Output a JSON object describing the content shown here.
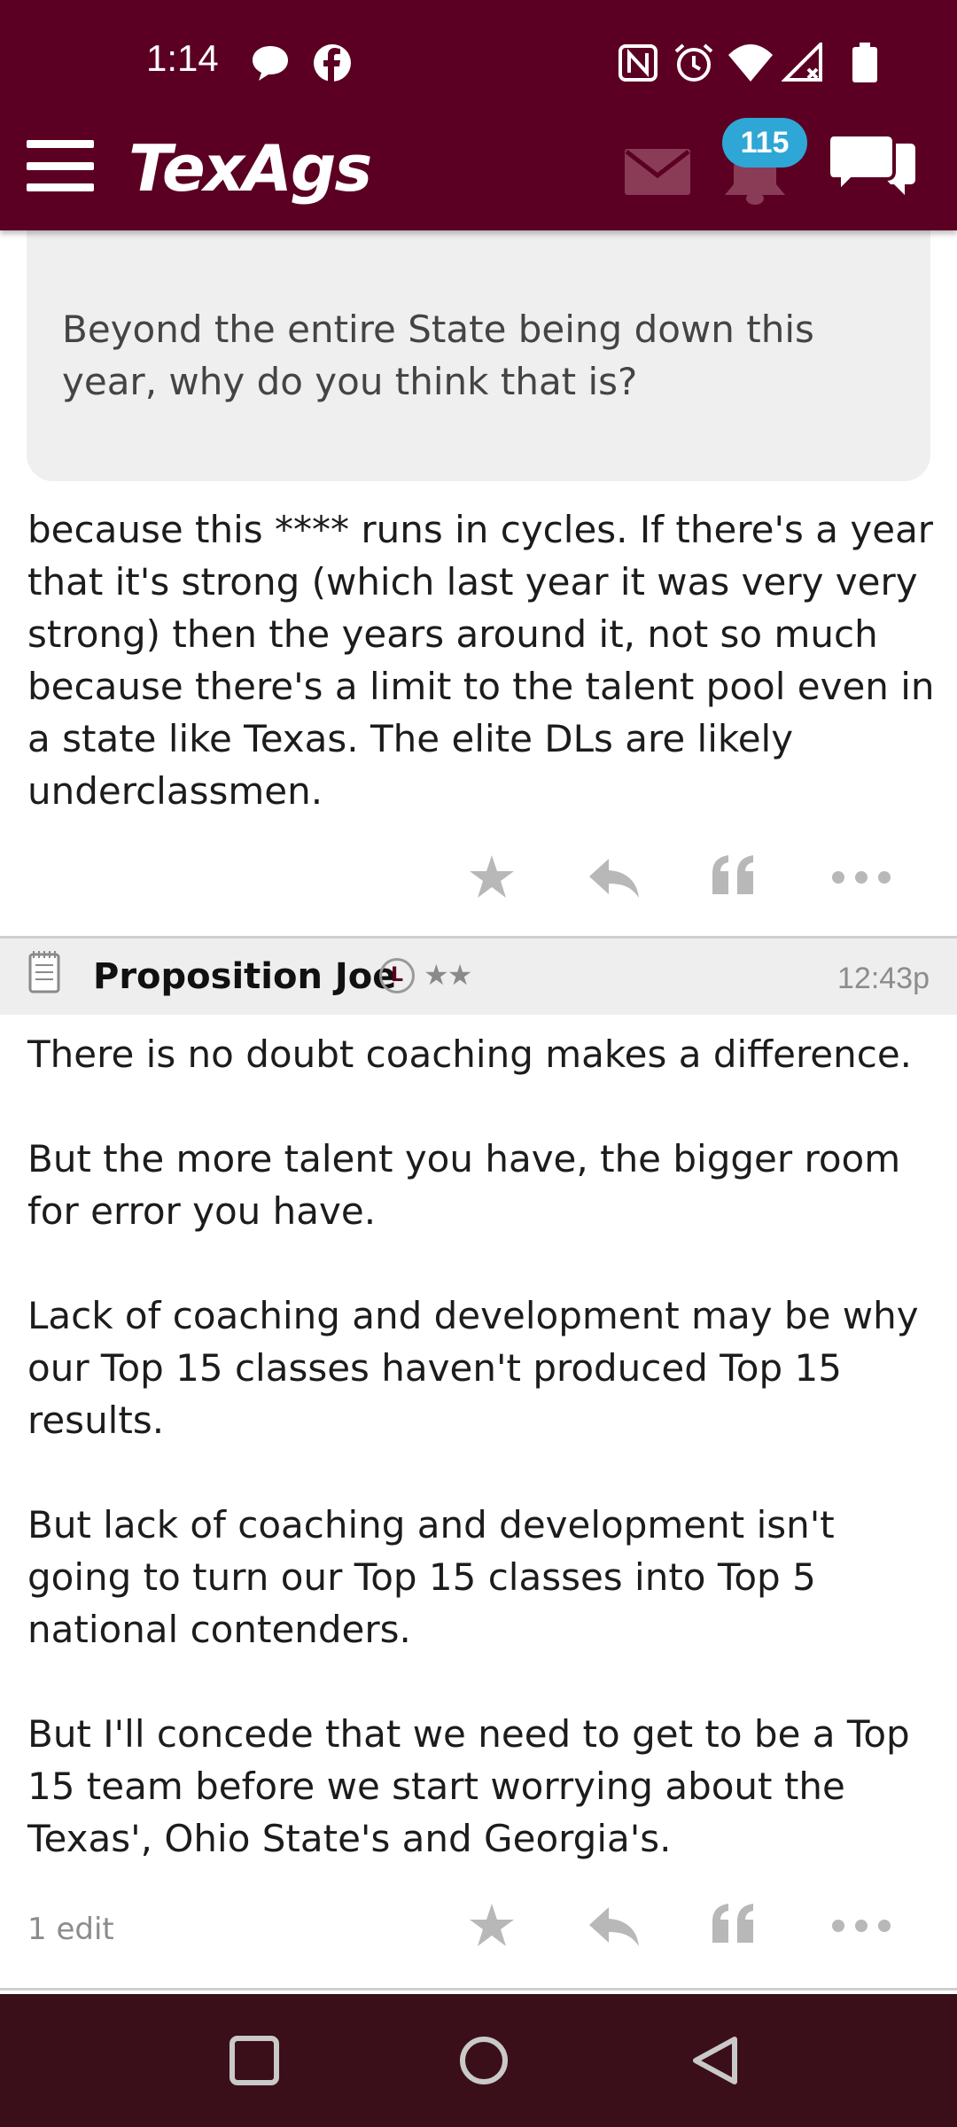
{
  "status_bar": {
    "time": "1:14",
    "left_icons": [
      "chat-bubble-icon",
      "facebook-icon"
    ],
    "right_icons": [
      "nfc-icon",
      "alarm-icon",
      "wifi-icon",
      "cell-signal-icon",
      "battery-icon"
    ]
  },
  "app_header": {
    "logo_text": "TexAgs",
    "notification_count": "115",
    "colors": {
      "header_bg": "#5b0022",
      "badge_bg": "#2ea7d6"
    }
  },
  "quoted_post": {
    "text": "Beyond the entire State being down this year, why do you think that is?"
  },
  "post_1": {
    "body": "because this **** runs in cycles. If there's a year that it's strong (which last year it was very very strong) then the years around it, not so much because there's a limit to the talent pool even in a state like Texas. The elite DLs are likely underclassmen."
  },
  "post_2": {
    "author": "Proposition Joe",
    "level_badge": "L",
    "stars": "★★",
    "timestamp": "12:43p",
    "body": "There is no doubt coaching makes a difference.\n\nBut the more talent you have, the bigger room for error you have.\n\nLack of coaching and development may be why our Top 15 classes haven't produced Top 15 results.\n\nBut lack of coaching and development isn't going to turn our Top 15 classes into Top 5 national contenders.\n\nBut I'll concede that we need to get to be a Top 15 team before we start worrying about the Texas', Ohio State's and Georgia's.",
    "edit_note": "1 edit"
  },
  "post_actions": [
    "star-icon",
    "reply-icon",
    "quote-icon",
    "more-icon"
  ],
  "nav_bar": [
    "recents-button",
    "home-button",
    "back-button"
  ]
}
